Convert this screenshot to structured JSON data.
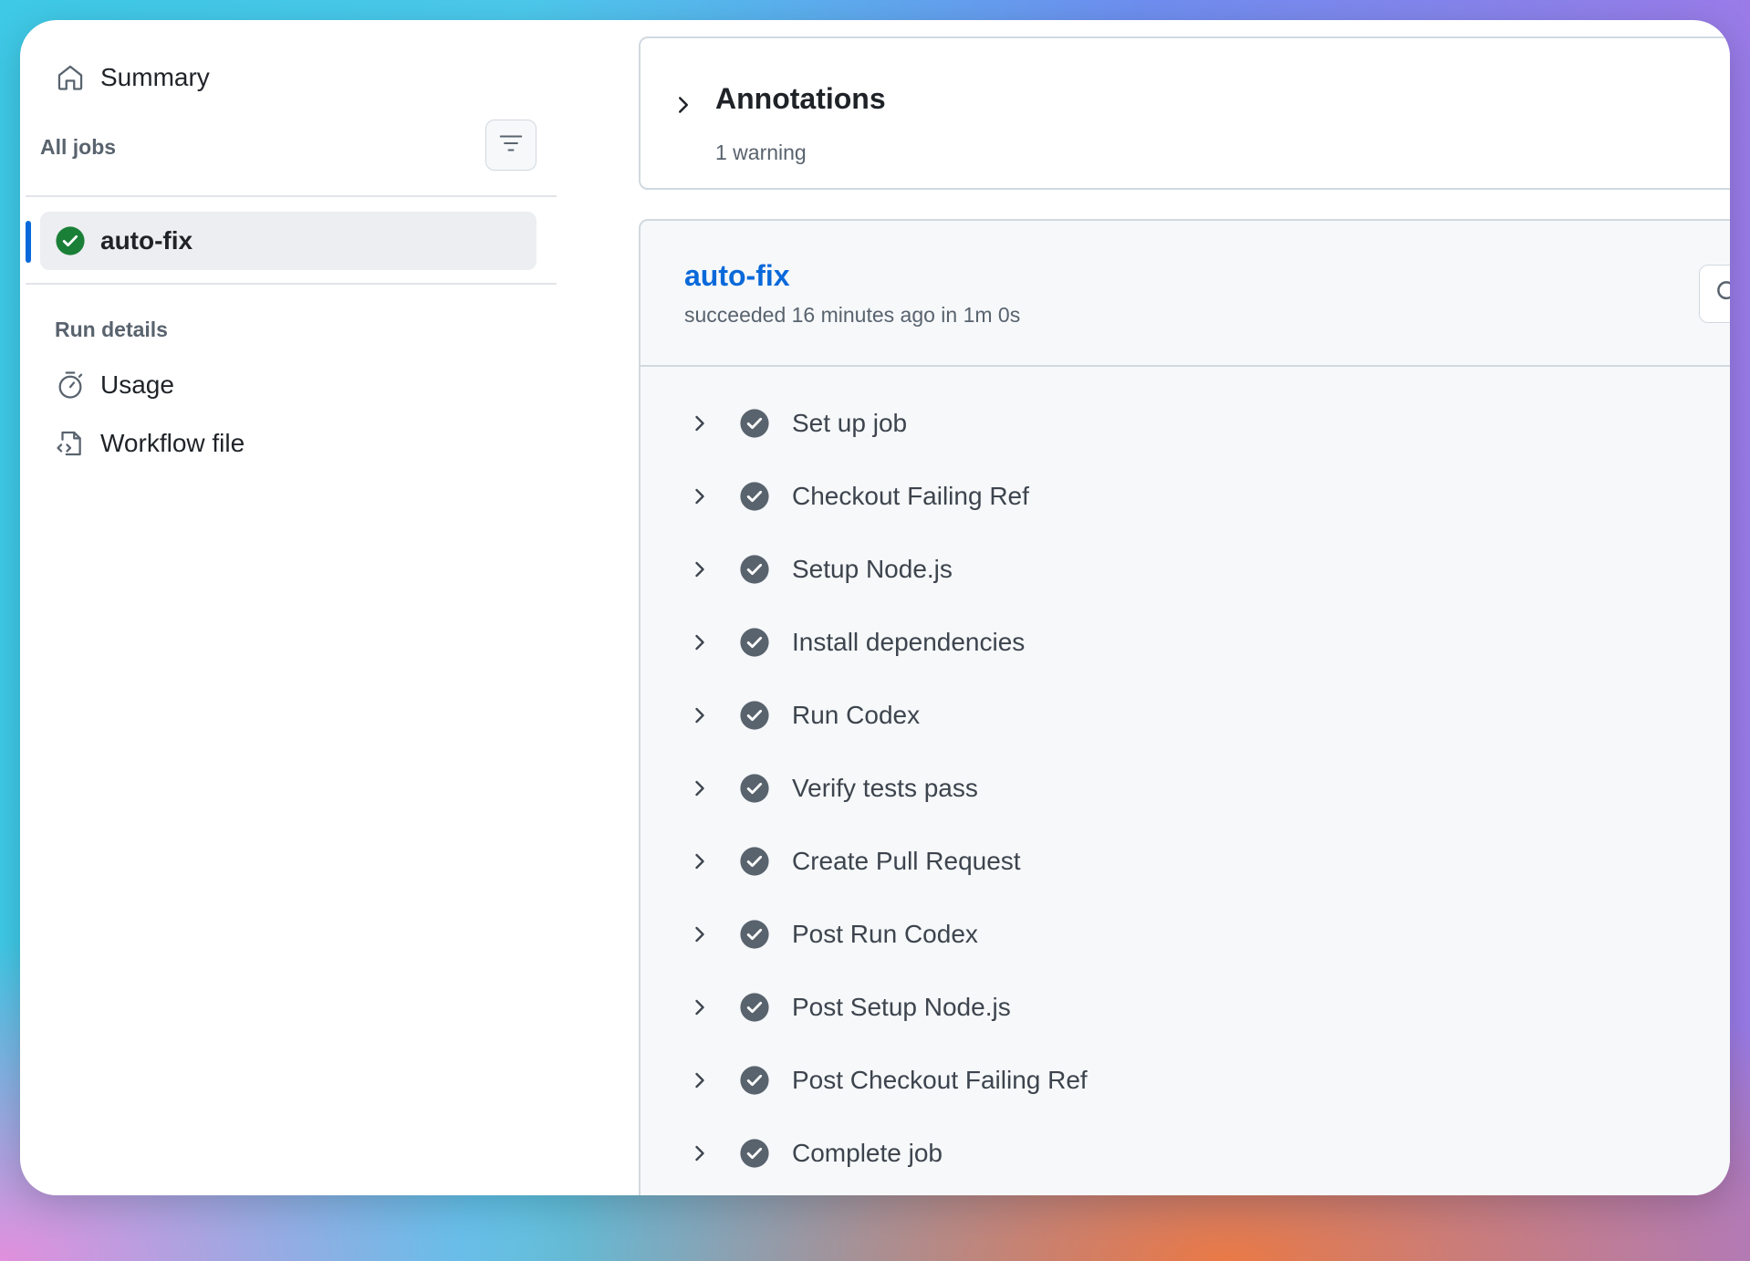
{
  "sidebar": {
    "summary_label": "Summary",
    "all_jobs_label": "All jobs",
    "jobs": [
      {
        "label": "auto-fix",
        "status": "success"
      }
    ],
    "run_details_label": "Run details",
    "usage_label": "Usage",
    "workflow_file_label": "Workflow file"
  },
  "annotations": {
    "title": "Annotations",
    "subtitle": "1 warning"
  },
  "job": {
    "title": "auto-fix",
    "meta": "succeeded 16 minutes ago in 1m 0s",
    "steps": [
      "Set up job",
      "Checkout Failing Ref",
      "Setup Node.js",
      "Install dependencies",
      "Run Codex",
      "Verify tests pass",
      "Create Pull Request",
      "Post Run Codex",
      "Post Setup Node.js",
      "Post Checkout Failing Ref",
      "Complete job"
    ]
  },
  "colors": {
    "accent": "#0969da",
    "success": "#1a7f37",
    "step_check": "#59636e"
  },
  "icons": {
    "summary": "home-icon",
    "filter": "filter-icon",
    "job_status": "check-circle-fill-icon",
    "usage": "stopwatch-icon",
    "workflow_file": "file-code-icon",
    "expand": "chevron-right-icon",
    "search": "search-icon"
  }
}
